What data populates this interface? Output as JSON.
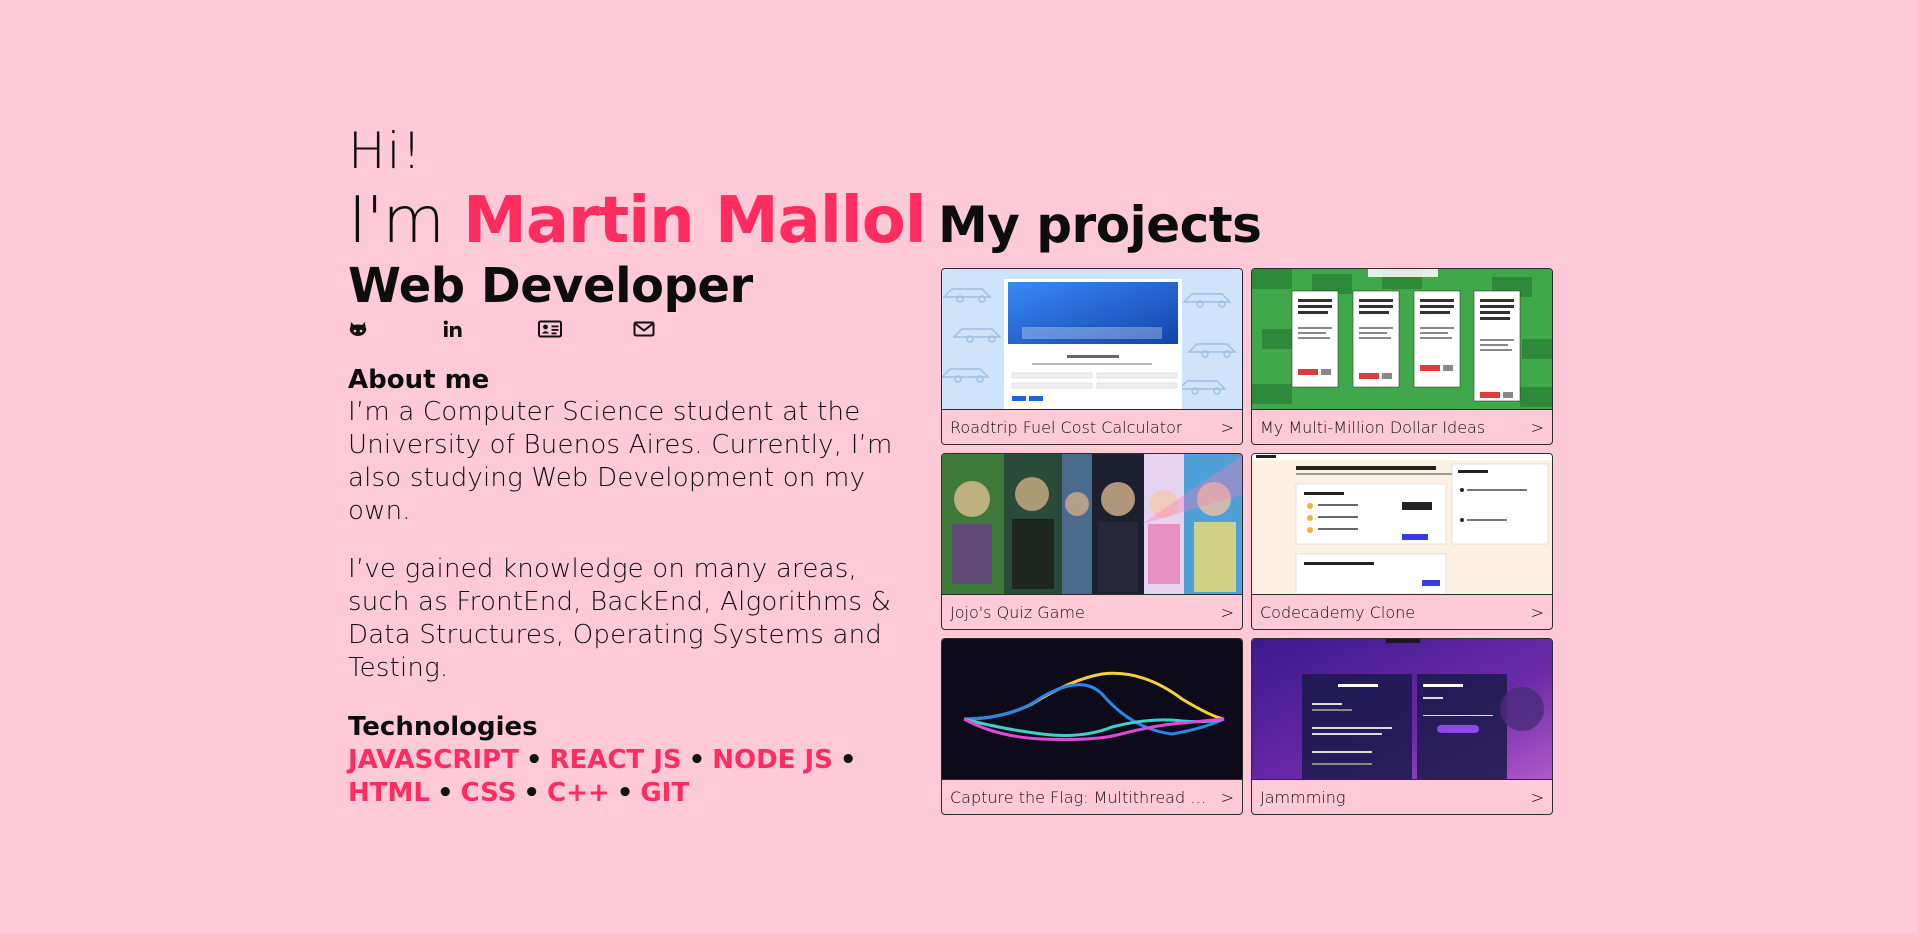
{
  "intro": {
    "greeting": "Hi!",
    "im": "I'm ",
    "name": "Martin Mallol",
    "role": "Web Developer"
  },
  "socials": [
    {
      "icon": "github-icon"
    },
    {
      "icon": "linkedin-icon"
    },
    {
      "icon": "id-card-icon"
    },
    {
      "icon": "envelope-icon"
    }
  ],
  "about": {
    "title": "About me",
    "paragraphs": [
      "I’m a Computer Science student at the University of Buenos Aires. Currently, I’m also studying Web Development on my own.",
      "I’ve gained knowledge on many areas, such as FrontEnd, BackEnd, Algorithms & Data Structures, Operating Systems and Testing."
    ]
  },
  "technologies": {
    "title": "Technologies",
    "items": [
      "JAVASCRIPT",
      "REACT JS",
      "NODE JS",
      "HTML",
      "CSS",
      "C++",
      "GIT"
    ],
    "separator": "•"
  },
  "projects": {
    "title": "My projects",
    "items": [
      {
        "title": "Roadtrip Fuel Cost Calculator",
        "arrow": ">"
      },
      {
        "title": "My Multi-Million Dollar Ideas",
        "arrow": ">"
      },
      {
        "title": "Jojo's Quiz Game",
        "arrow": ">"
      },
      {
        "title": "Codecademy Clone",
        "arrow": ">"
      },
      {
        "title": "Capture the Flag: Multithread game",
        "arrow": ">"
      },
      {
        "title": "Jammming",
        "arrow": ">"
      }
    ]
  },
  "colors": {
    "background": "#ffcad8",
    "accent": "#ff2c5f",
    "text": "#0d0d0d"
  }
}
